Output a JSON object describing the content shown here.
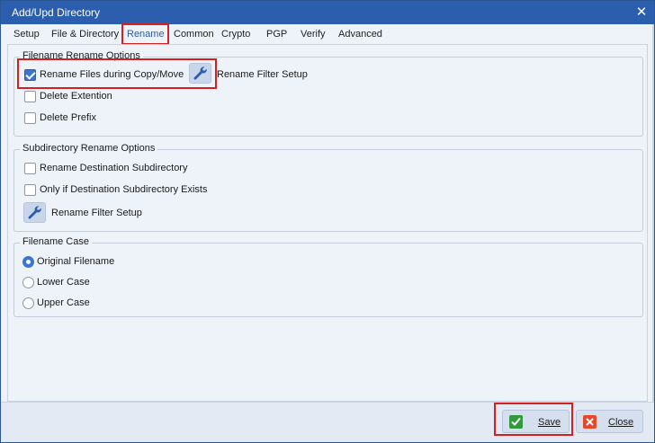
{
  "window": {
    "title": "Add/Upd Directory",
    "close_glyph": "✕"
  },
  "tabs": [
    {
      "label": "Setup"
    },
    {
      "label": "File & Directory"
    },
    {
      "label": "Rename",
      "active": true
    },
    {
      "label": "Common"
    },
    {
      "label": "Crypto"
    },
    {
      "label": "PGP"
    },
    {
      "label": "Verify"
    },
    {
      "label": "Advanced"
    }
  ],
  "filename_rename": {
    "title": "Filename Rename Options",
    "rename_files": {
      "label": "Rename Files during Copy/Move",
      "checked": true
    },
    "filter_setup_label": "Rename Filter Setup",
    "delete_extension": {
      "label": "Delete Extention",
      "checked": false
    },
    "delete_prefix": {
      "label": "Delete Prefix",
      "checked": false
    }
  },
  "subdir_rename": {
    "title": "Subdirectory Rename Options",
    "rename_dest": {
      "label": "Rename Destination Subdirectory",
      "checked": false
    },
    "only_if_exists": {
      "label": "Only if Destination Subdirectory Exists",
      "checked": false
    },
    "filter_setup_label": "Rename Filter Setup"
  },
  "filename_case": {
    "title": "Filename Case",
    "options": [
      {
        "label": "Original Filename",
        "selected": true
      },
      {
        "label": "Lower Case",
        "selected": false
      },
      {
        "label": "Upper Case",
        "selected": false
      }
    ]
  },
  "buttons": {
    "save_label": "Save",
    "close_label": "Close"
  },
  "icons": {
    "wrench": "wrench-icon",
    "save": "checkmark-icon",
    "close": "x-icon"
  },
  "colors": {
    "titlebar": "#2b5fad",
    "accent": "#3a76d0",
    "highlight_box": "#d42020",
    "save_icon": "#2e9a3c",
    "close_icon": "#e24a2a"
  }
}
